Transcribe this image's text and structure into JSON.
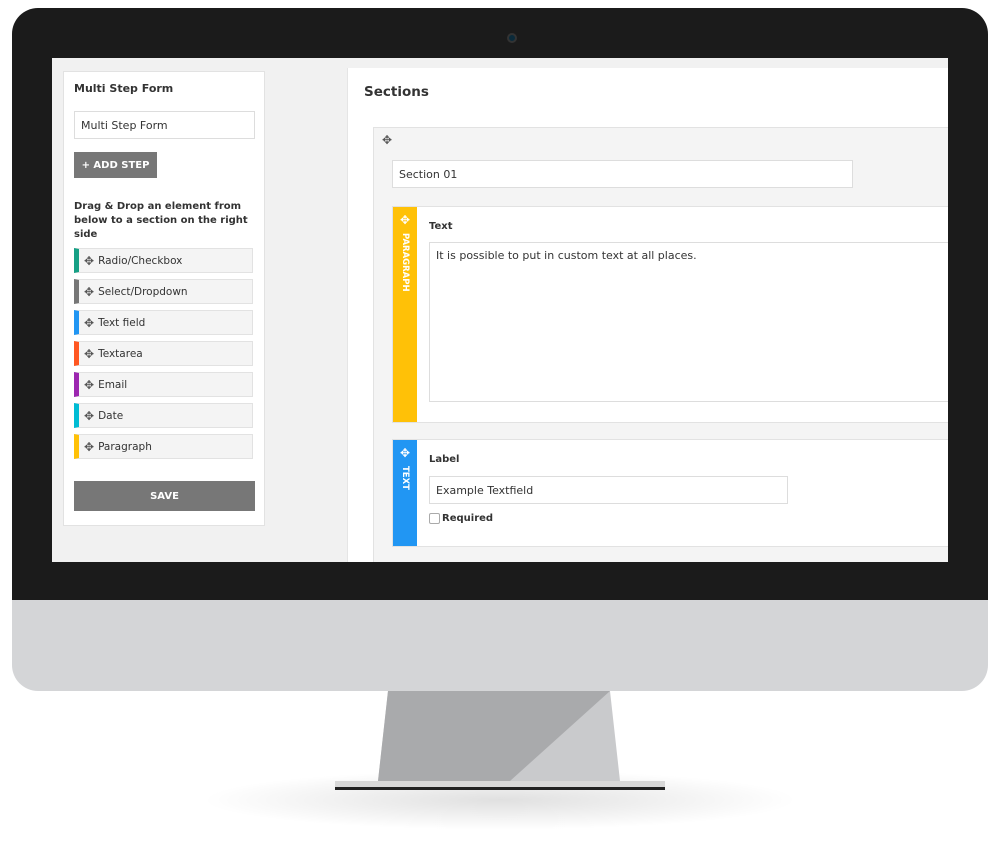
{
  "sidebar": {
    "title": "Multi Step Form",
    "form_name_value": "Multi Step Form",
    "add_step_label": "+ ADD STEP",
    "hint": "Drag & Drop an element from below to a section on the right side",
    "elements": [
      {
        "label": "Radio/Checkbox",
        "color": "#16a085"
      },
      {
        "label": "Select/Dropdown",
        "color": "#777777"
      },
      {
        "label": "Text field",
        "color": "#2196f3"
      },
      {
        "label": "Textarea",
        "color": "#ff5722"
      },
      {
        "label": "Email",
        "color": "#9c27b0"
      },
      {
        "label": "Date",
        "color": "#00bcd4"
      },
      {
        "label": "Paragraph",
        "color": "#ffc107"
      }
    ],
    "save_label": "SAVE"
  },
  "main": {
    "title": "Sections",
    "section": {
      "name_value": "Section 01",
      "paragraph": {
        "tag": "PARAGRAPH",
        "color": "#ffc107",
        "label": "Text",
        "value": "It is possible to put in custom text at all places."
      },
      "textfield": {
        "tag": "TEXT",
        "color": "#2196f3",
        "label": "Label",
        "value": "Example Textfield",
        "required_label": "Required",
        "required": false
      }
    }
  },
  "icons": {
    "move": "move-arrows-icon"
  }
}
